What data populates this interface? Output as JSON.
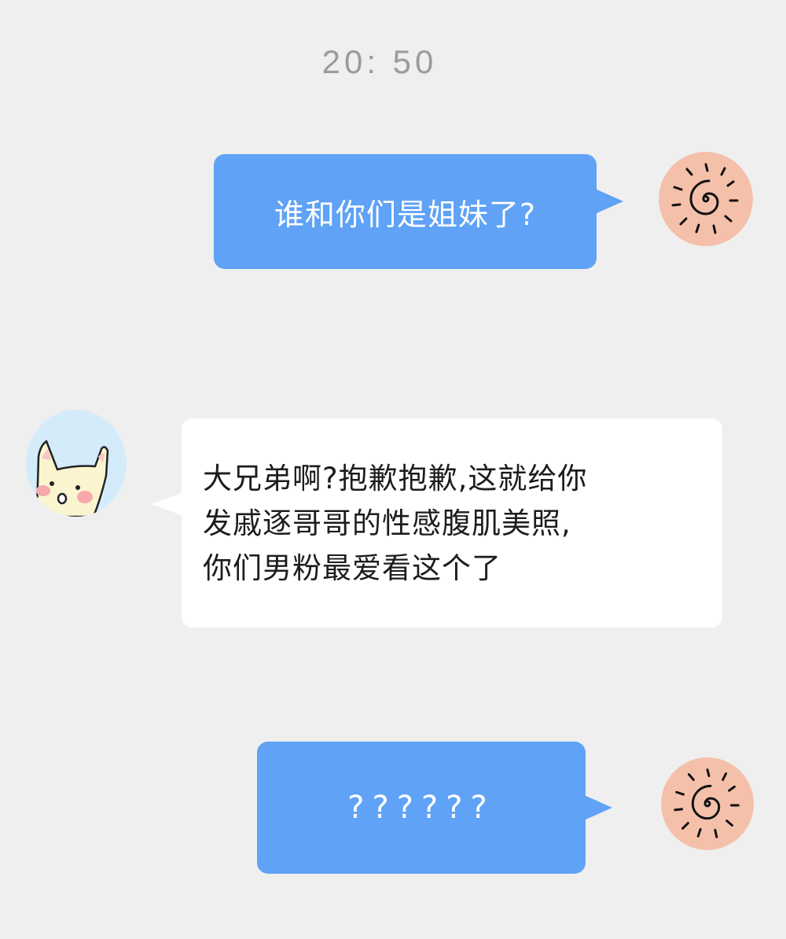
{
  "chat": {
    "timestamp": "20: 50",
    "messages": [
      {
        "sender": "self",
        "text": "谁和你们是姐妹了?"
      },
      {
        "sender": "other",
        "text": "大兄弟啊?抱歉抱歉,这就给你\n发戚逐哥哥的性感腹肌美照,\n你们男粉最爱看这个了"
      },
      {
        "sender": "self",
        "text": "??????"
      }
    ]
  },
  "colors": {
    "background": "#efefef",
    "outgoing_bubble": "#5fa2f6",
    "incoming_bubble": "#ffffff",
    "sun_avatar_bg": "#f5c0aa",
    "cat_avatar_bg": "#d4ebfa"
  },
  "icons": {
    "self_avatar": "sun-spiral-icon",
    "other_avatar": "cat-face-icon"
  }
}
